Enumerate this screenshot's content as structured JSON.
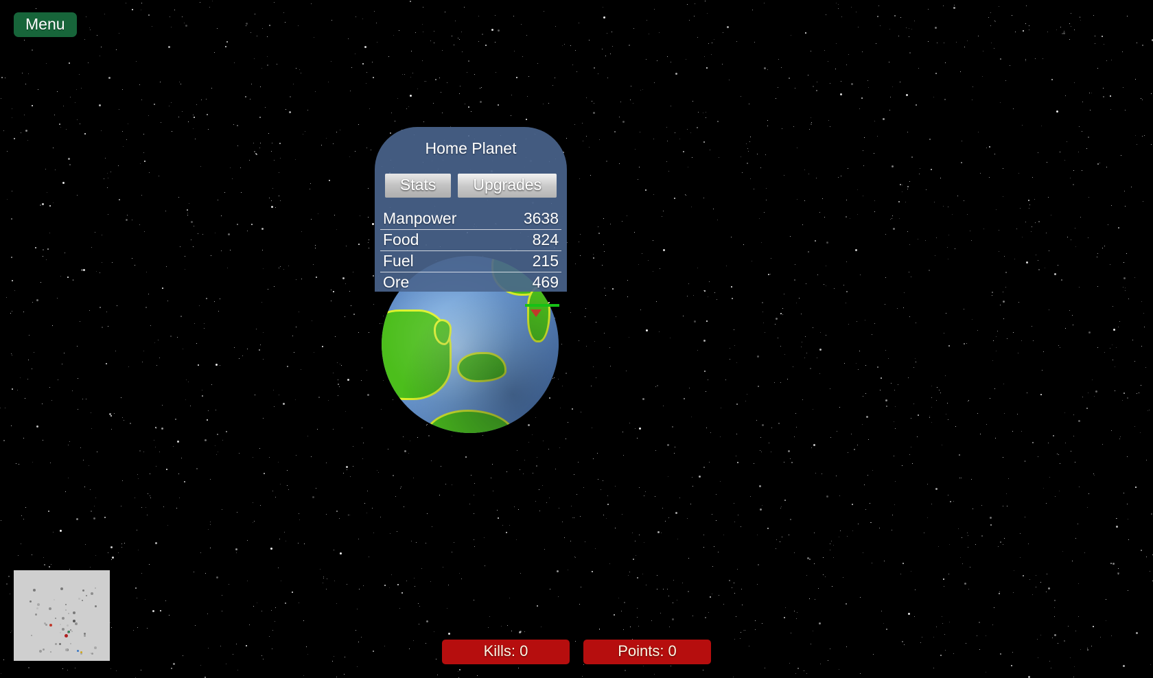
{
  "hud": {
    "menu_label": "Menu",
    "menu_color": "#17653a"
  },
  "planet_panel": {
    "title": "Home Planet",
    "tabs": [
      {
        "label": "Stats",
        "active": true
      },
      {
        "label": "Upgrades",
        "active": false
      }
    ],
    "stats": [
      {
        "label": "Manpower",
        "value": "3638"
      },
      {
        "label": "Food",
        "value": "824"
      },
      {
        "label": "Fuel",
        "value": "215"
      },
      {
        "label": "Ore",
        "value": "469"
      }
    ],
    "panel_color": "#4a658e"
  },
  "planet": {
    "ocean_color": "#6a97ce",
    "land_color": "#4cbe1c",
    "land_outline_color": "#ddf22a"
  },
  "unit_marker": {
    "health_color": "#16c116",
    "icon_color": "#c0392b"
  },
  "minimap": {
    "background_color": "#cfcfcf"
  },
  "status": {
    "kills_label": "Kills: 0",
    "points_label": "Points: 0",
    "chip_color": "#b60e0e"
  }
}
